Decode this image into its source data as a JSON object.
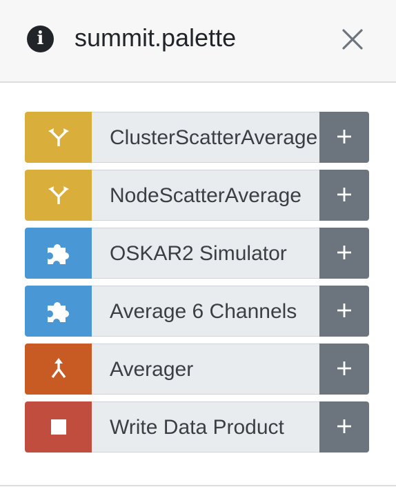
{
  "header": {
    "title": "summit.palette",
    "info_glyph": "i",
    "info_icon": "info-circle-icon",
    "close_icon": "close-icon"
  },
  "palette": {
    "items": [
      {
        "label": "ClusterScatterAverage",
        "icon": "fork-icon",
        "color": "#d9ae3a"
      },
      {
        "label": "NodeScatterAverage",
        "icon": "fork-icon",
        "color": "#d9ae3a"
      },
      {
        "label": "OSKAR2 Simulator",
        "icon": "puzzle-icon",
        "color": "#4a97d6"
      },
      {
        "label": "Average 6 Channels",
        "icon": "puzzle-icon",
        "color": "#4a97d6"
      },
      {
        "label": "Averager",
        "icon": "merge-icon",
        "color": "#c85a24"
      },
      {
        "label": "Write Data Product",
        "icon": "stop-square-icon",
        "color": "#c14d3f"
      }
    ],
    "add_icon": "plus-icon"
  }
}
